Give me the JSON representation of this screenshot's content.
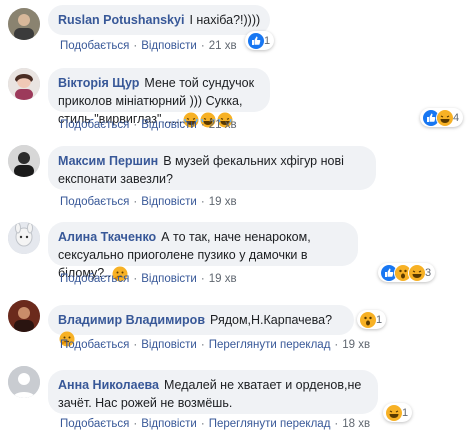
{
  "comments": [
    {
      "author": "Ruslan Potushanskyi",
      "text": "І нахіба?!))))",
      "like": "Подобається",
      "reply": "Відповісти",
      "time": "21 хв",
      "reactions": {
        "icons": [
          "like-icon"
        ],
        "count": "1"
      }
    },
    {
      "author": "Вікторія Щур",
      "text": "Мене той сундучок приколов мініатюрний ))) Сукка, стиль \"вирвиглаз\"......",
      "emoji": [
        "laughing-emoji",
        "laughing-emoji",
        "laughing-emoji"
      ],
      "like": "Подобається",
      "reply": "Відповісти",
      "time": "21 хв",
      "reactions": {
        "icons": [
          "like-icon",
          "haha-icon"
        ],
        "count": "4"
      }
    },
    {
      "author": "Максим Першин",
      "text": "В музей фекальних хфігур нові експонати завезли?",
      "like": "Подобається",
      "reply": "Відповісти",
      "time": "19 хв"
    },
    {
      "author": "Алина Ткаченко",
      "text": "А то так, наче ненароком, сексуально приоголене пузико у дамочки в білому?..",
      "emoji": [
        "thinking-emoji"
      ],
      "like": "Подобається",
      "reply": "Відповісти",
      "time": "19 хв",
      "reactions": {
        "icons": [
          "like-icon",
          "wow-icon",
          "haha-icon"
        ],
        "count": "3"
      }
    },
    {
      "author": "Владимир Владимиров",
      "text": "Рядом,Н.Карпачева?",
      "emoji": [
        "thinking-emoji"
      ],
      "like": "Подобається",
      "reply": "Відповісти",
      "translate": "Переглянути переклад",
      "time": "19 хв",
      "reactions": {
        "icons": [
          "wow-icon"
        ],
        "count": "1"
      }
    },
    {
      "author": "Анна Николаева",
      "text": "Медалей не хватает и орденов,не зачёт. Нас рожей не возмёшь.",
      "like": "Подобається",
      "reply": "Відповісти",
      "translate": "Переглянути переклад",
      "time": "18 хв",
      "reactions": {
        "icons": [
          "haha-icon"
        ],
        "count": "1"
      }
    }
  ],
  "colors": {
    "link": "#385898",
    "bubble": "#f0f2f5",
    "meta": "#606770",
    "like_blue": "#1877f2",
    "emoji_yellow": "#f7b125"
  }
}
